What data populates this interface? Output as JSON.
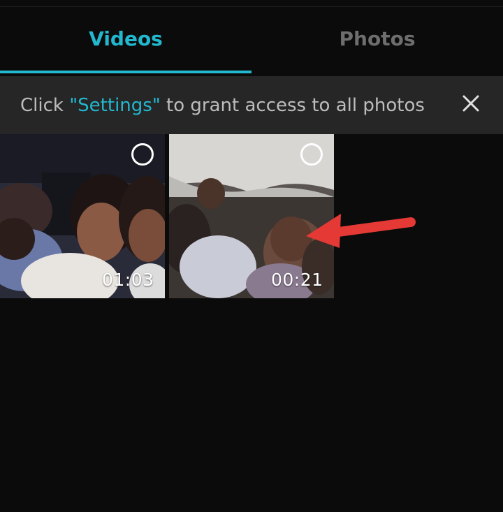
{
  "tabs": [
    {
      "label": "Videos",
      "active": true
    },
    {
      "label": "Photos",
      "active": false
    }
  ],
  "banner": {
    "prefix": "Click ",
    "link": "\"Settings\"",
    "suffix": " to grant access to all photos",
    "close_icon": "close-icon"
  },
  "videos": [
    {
      "duration": "01:03",
      "selected": false
    },
    {
      "duration": "00:21",
      "selected": false
    }
  ],
  "colors": {
    "accent": "#22b8cf",
    "background": "#0b0b0b",
    "banner": "#262626",
    "annotation_arrow": "#e53935"
  }
}
